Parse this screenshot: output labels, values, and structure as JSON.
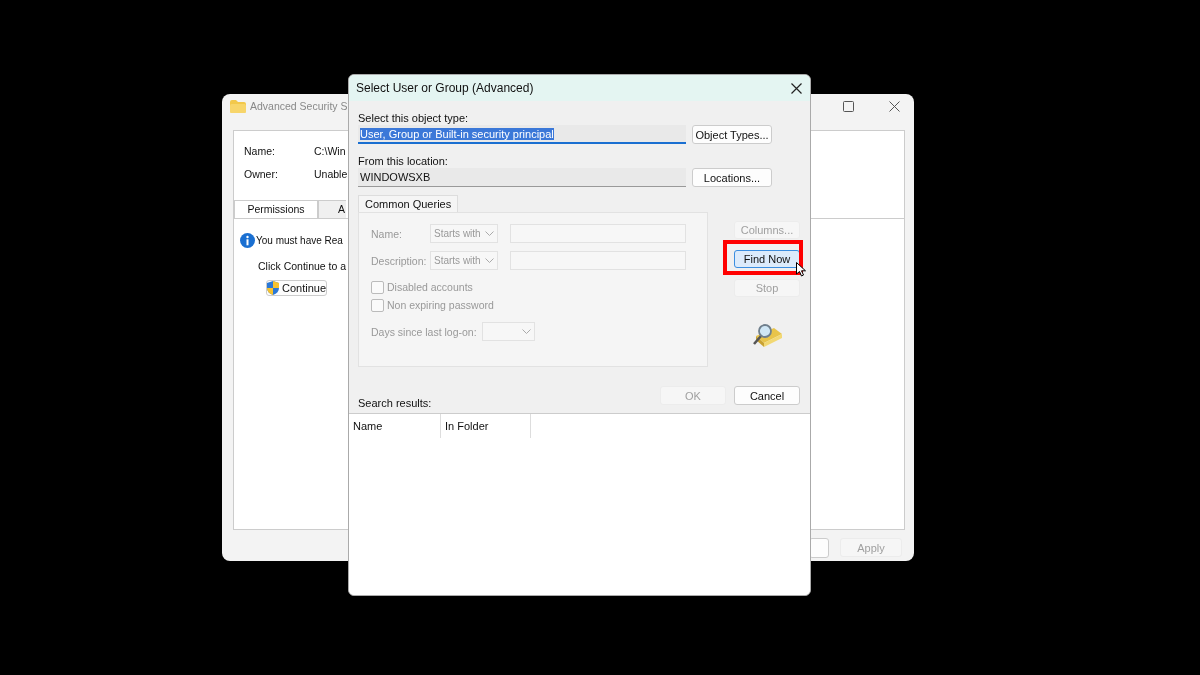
{
  "background_window": {
    "title": "Advanced Security S",
    "fields": [
      {
        "label": "Name:",
        "value": "C:\\Win"
      },
      {
        "label": "Owner:",
        "value": "Unable"
      }
    ],
    "tabs": [
      {
        "label": "Permissions",
        "selected": true
      },
      {
        "label": "A",
        "selected": false
      }
    ],
    "info_text": "You must have Rea",
    "continue_text": "Click Continue to a",
    "continue_button": "Continue",
    "apply_button": {
      "label": "Apply",
      "disabled": true
    }
  },
  "dialog": {
    "title": "Select User or Group (Advanced)",
    "object_type_label": "Select this object type:",
    "object_type_value": "User, Group or Built-in security principal",
    "object_type_value_selected": true,
    "object_types_button": "Object Types...",
    "location_label": "From this location:",
    "location_value": "WINDOWSXB",
    "locations_button": "Locations...",
    "query_tab": "Common Queries",
    "query_disabled": true,
    "query_fields": [
      {
        "label": "Name:",
        "operator": "Starts with"
      },
      {
        "label": "Description:",
        "operator": "Starts with"
      }
    ],
    "checkboxes": [
      {
        "label": "Disabled accounts",
        "checked": false
      },
      {
        "label": "Non expiring password",
        "checked": false
      }
    ],
    "days_label": "Days since last log-on:",
    "side_buttons": [
      {
        "label": "Columns...",
        "disabled": true,
        "focused": false,
        "highlighted": false
      },
      {
        "label": "Find Now",
        "disabled": false,
        "focused": true,
        "highlighted": true
      },
      {
        "label": "Stop",
        "disabled": true,
        "focused": false,
        "highlighted": false
      }
    ],
    "ok_button": {
      "label": "OK",
      "disabled": true
    },
    "cancel_button": {
      "label": "Cancel",
      "disabled": false
    },
    "results_label": "Search results:",
    "results_columns": [
      "Name",
      "In Folder"
    ]
  }
}
